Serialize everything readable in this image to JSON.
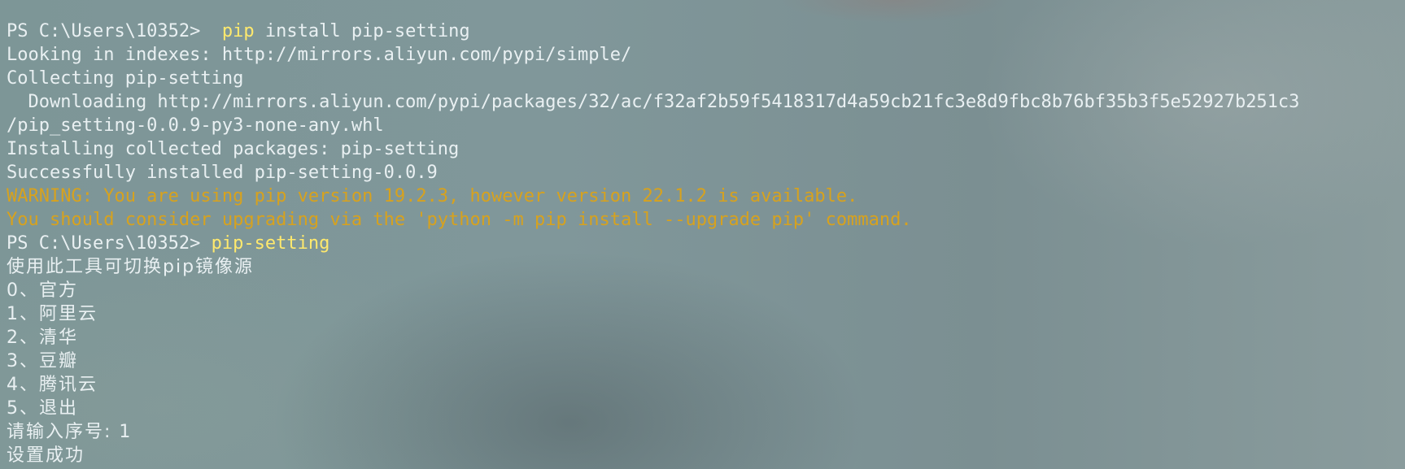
{
  "terminal": {
    "prompt": "PS C:\\Users\\10352>",
    "cmd1": {
      "program": "pip",
      "args": "install pip-setting"
    },
    "lines": [
      "Looking in indexes: http://mirrors.aliyun.com/pypi/simple/",
      "Collecting pip-setting",
      "  Downloading http://mirrors.aliyun.com/pypi/packages/32/ac/f32af2b59f5418317d4a59cb21fc3e8d9fbc8b76bf35b3f5e52927b251c3",
      "/pip_setting-0.0.9-py3-none-any.whl",
      "Installing collected packages: pip-setting",
      "Successfully installed pip-setting-0.0.9"
    ],
    "warnings": [
      "WARNING: You are using pip version 19.2.3, however version 22.1.2 is available.",
      "You should consider upgrading via the 'python -m pip install --upgrade pip' command."
    ],
    "cmd2": "pip-setting",
    "menu": {
      "intro": "使用此工具可切换pip镜像源",
      "options": [
        "0、官方",
        "1、阿里云",
        "2、清华",
        "3、豆瓣",
        "4、腾讯云",
        "5、退出"
      ],
      "input_prompt": "请输入序号: 1",
      "result": "设置成功"
    },
    "colors": {
      "text": "#e9f0f2",
      "command_highlight": "#ffe96d",
      "warning": "#d7a21e"
    }
  }
}
